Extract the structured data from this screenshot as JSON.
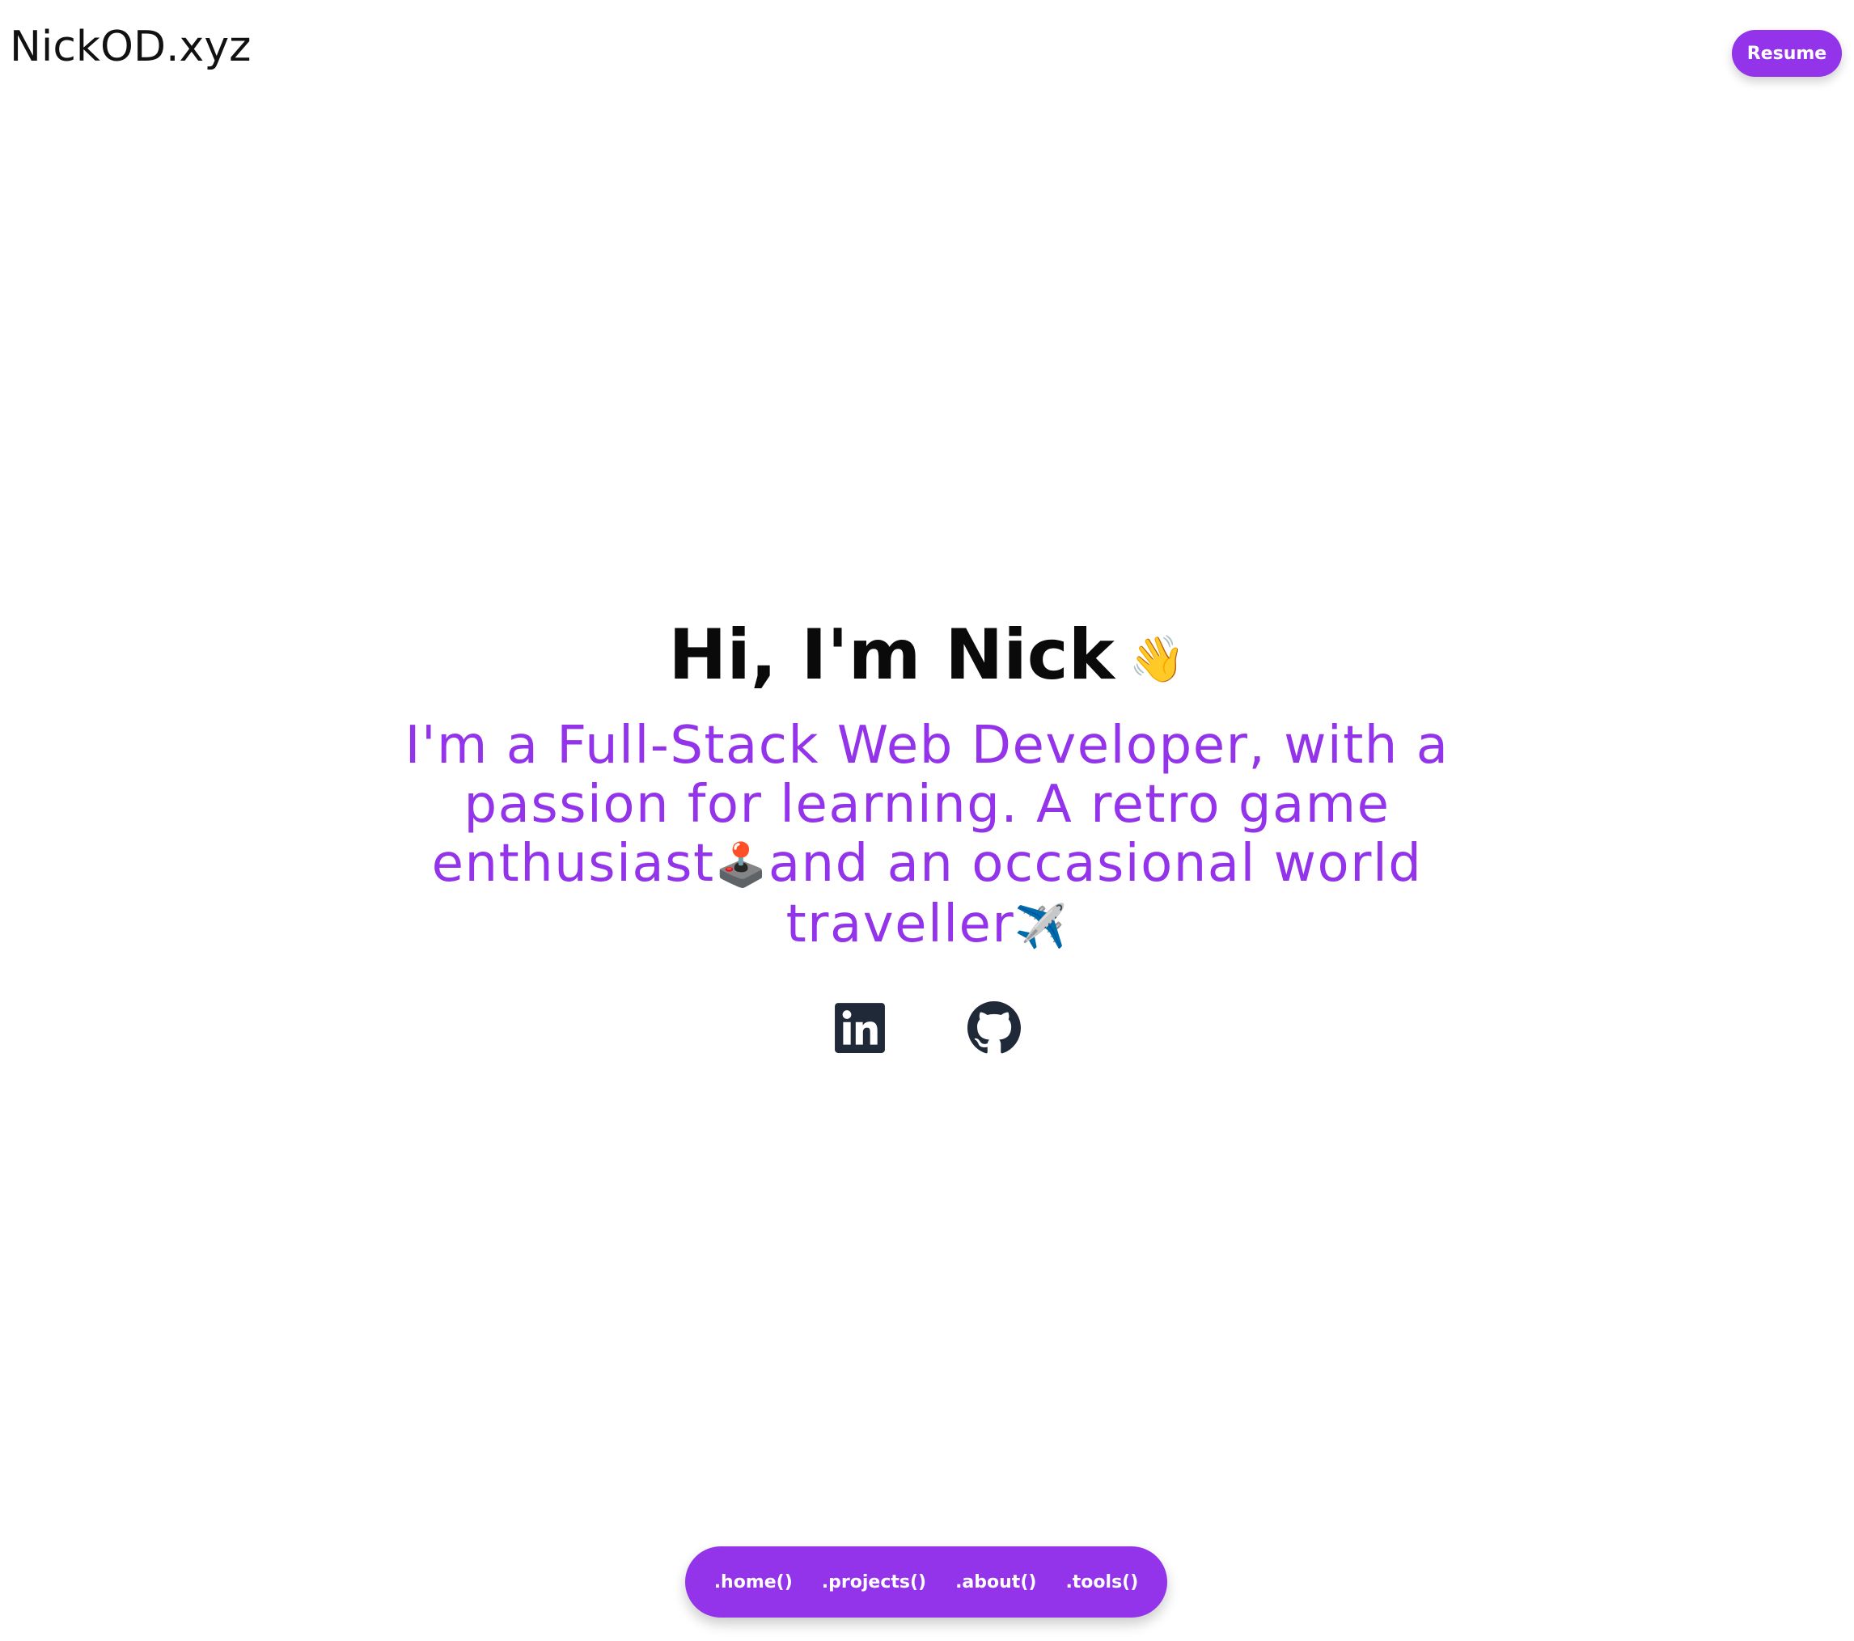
{
  "header": {
    "logo": "NickOD.xyz",
    "resume_label": "Resume"
  },
  "hero": {
    "title": "Hi, I'm Nick",
    "wave_emoji": "👋",
    "subtitle_part1": "I'm a Full-Stack Web Developer, with a passion for learning. A retro game enthusiast",
    "joystick_emoji": "🕹️",
    "subtitle_part2": "and an occasional world traveller",
    "plane_emoji": "✈️"
  },
  "socials": [
    {
      "icon": "linkedin-icon"
    },
    {
      "icon": "github-icon"
    }
  ],
  "bottom_nav": {
    "items": [
      ".home()",
      ".projects()",
      ".about()",
      ".tools()"
    ]
  },
  "colors": {
    "accent": "#9333ea",
    "text": "#0a0a0a",
    "icon": "#1f2937"
  }
}
